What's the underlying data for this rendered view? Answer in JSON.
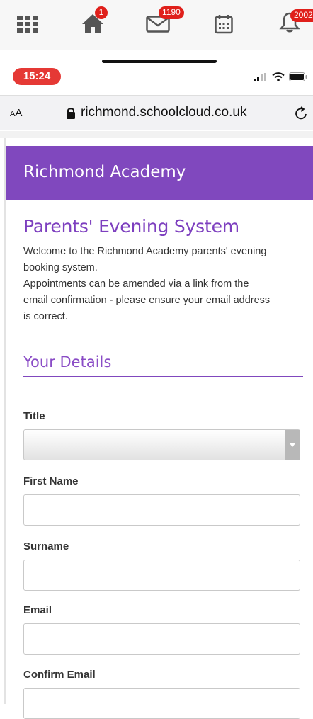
{
  "app_tabs": [
    {
      "name": "apps",
      "icon": "grid-icon",
      "badge": ""
    },
    {
      "name": "home",
      "icon": "home-icon",
      "badge": "1"
    },
    {
      "name": "messages",
      "icon": "envelope-icon",
      "badge": "1190"
    },
    {
      "name": "calendar",
      "icon": "calendar-icon",
      "badge": ""
    },
    {
      "name": "notifications",
      "icon": "bell-icon",
      "badge": "2002"
    }
  ],
  "status_bar": {
    "time": "15:24",
    "icons": [
      "signal-icon",
      "wifi-icon",
      "battery-icon"
    ]
  },
  "browser": {
    "text_size_label": "AA",
    "url": "richmond.schoolcloud.co.uk"
  },
  "header": {
    "school_name": "Richmond Academy"
  },
  "main": {
    "title": "Parents' Evening System",
    "intro_lines": [
      "Welcome to the Richmond Academy parents' evening",
      "booking system.",
      "Appointments can be amended via a link from the",
      "email confirmation - please ensure your email address",
      "is correct."
    ],
    "section_title": "Your Details"
  },
  "form": {
    "title_label": "Title",
    "title_value": "",
    "first_name_label": "First Name",
    "first_name_value": "",
    "surname_label": "Surname",
    "surname_value": "",
    "email_label": "Email",
    "email_value": "",
    "confirm_email_label": "Confirm Email",
    "confirm_email_value": ""
  },
  "colors": {
    "brand": "#8048be",
    "badge": "#e0201b",
    "time_pill": "#e53935"
  }
}
